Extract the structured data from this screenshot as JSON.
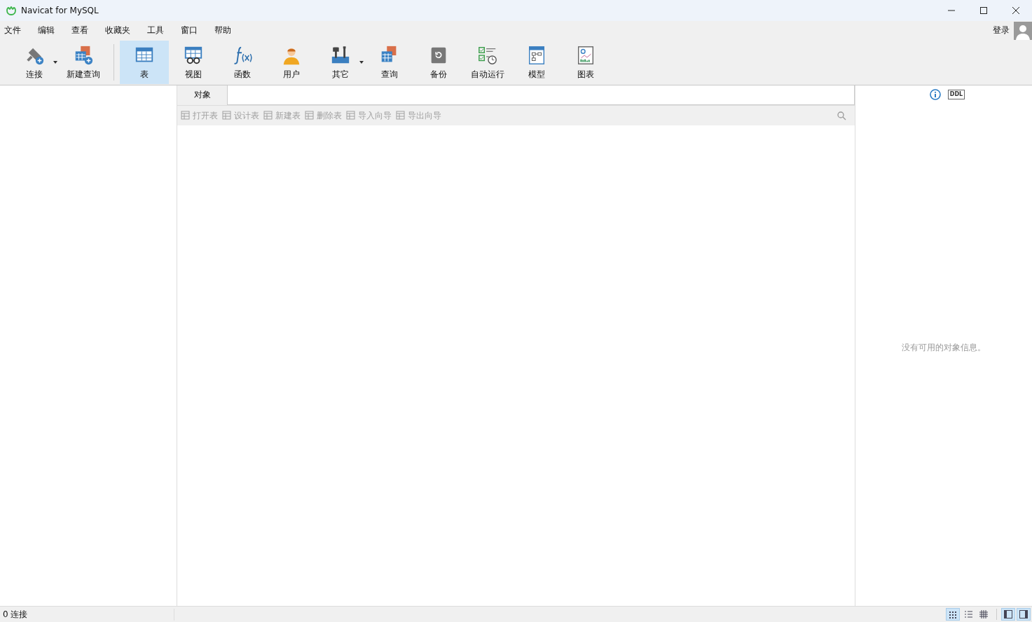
{
  "window": {
    "title": "Navicat for MySQL"
  },
  "menu": [
    "文件",
    "编辑",
    "查看",
    "收藏夹",
    "工具",
    "窗口",
    "帮助"
  ],
  "login": {
    "label": "登录"
  },
  "toolbar": [
    {
      "label": "连接",
      "selected": false,
      "dropdown": true
    },
    {
      "label": "新建查询",
      "selected": false,
      "dropdown": false
    },
    {
      "label": "表",
      "selected": true,
      "dropdown": false
    },
    {
      "label": "视图",
      "selected": false,
      "dropdown": false
    },
    {
      "label": "函数",
      "selected": false,
      "dropdown": false
    },
    {
      "label": "用户",
      "selected": false,
      "dropdown": false
    },
    {
      "label": "其它",
      "selected": false,
      "dropdown": true
    },
    {
      "label": "查询",
      "selected": false,
      "dropdown": false
    },
    {
      "label": "备份",
      "selected": false,
      "dropdown": false
    },
    {
      "label": "自动运行",
      "selected": false,
      "dropdown": false
    },
    {
      "label": "模型",
      "selected": false,
      "dropdown": false
    },
    {
      "label": "图表",
      "selected": false,
      "dropdown": false
    }
  ],
  "object_tab": {
    "label": "对象",
    "selected": true
  },
  "object_actions": [
    {
      "label": "打开表",
      "disabled": true
    },
    {
      "label": "设计表",
      "disabled": true
    },
    {
      "label": "新建表",
      "disabled": true
    },
    {
      "label": "删除表",
      "disabled": true
    },
    {
      "label": "导入向导",
      "disabled": true
    },
    {
      "label": "导出向导",
      "disabled": true
    }
  ],
  "info_panel": {
    "ddl_label": "DDL",
    "message": "没有可用的对象信息。"
  },
  "status_bar": {
    "text": "0 连接",
    "views": [
      {
        "selected": true
      },
      {
        "selected": false
      },
      {
        "selected": false
      }
    ],
    "panels": [
      {
        "selected": true
      },
      {
        "selected": true
      }
    ]
  }
}
